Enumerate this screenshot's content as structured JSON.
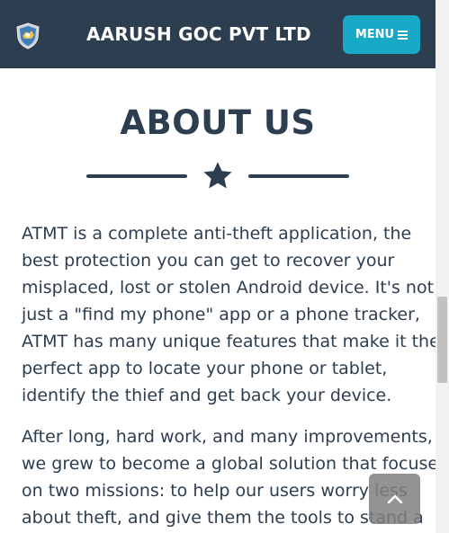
{
  "navbar": {
    "brand": "AARUSH GOC PVT LTD",
    "menu_label": "MENU",
    "logo_icon": "shield-logo-icon",
    "menu_icon": "bars-icon"
  },
  "about": {
    "title": "ABOUT US",
    "divider_icon": "star-icon",
    "paragraph1": [
      "ATMT is a complete anti-theft application, the",
      "best protection you can get to recover your",
      "misplaced, lost or stolen Android device. It's not",
      "just a \"find my phone\" app or a phone tracker,",
      "ATMT has many unique features that make it the",
      "perfect app to locate your phone or tablet,",
      "identify the thief and get back your device."
    ],
    "paragraph2": [
      "After long, hard work, and many improvements,",
      "we grew to become a global solution that focuses",
      "on two missions: to help our users worry less",
      "about theft, and give them the tools to stand a"
    ]
  },
  "scroll_top": {
    "icon": "chevron-up-icon"
  },
  "colors": {
    "navbar_bg": "#2c3e50",
    "menu_button_bg": "#18a9c6",
    "text": "#2c3e50"
  }
}
